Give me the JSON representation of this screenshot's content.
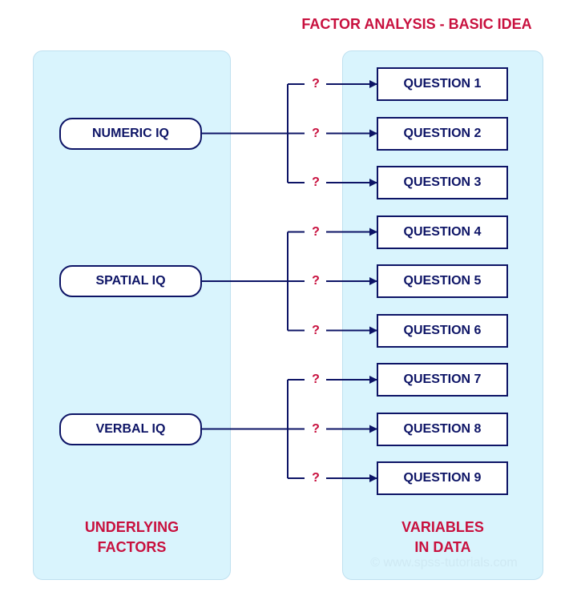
{
  "title": "FACTOR ANALYSIS - BASIC IDEA",
  "colors": {
    "accent": "#c8103e",
    "line": "#0d1466",
    "panel": "#d9f4fd"
  },
  "factors": [
    {
      "label": "NUMERIC IQ",
      "questions": [
        0,
        1,
        2
      ]
    },
    {
      "label": "SPATIAL IQ",
      "questions": [
        3,
        4,
        5
      ]
    },
    {
      "label": "VERBAL IQ",
      "questions": [
        6,
        7,
        8
      ]
    }
  ],
  "questions": [
    "QUESTION 1",
    "QUESTION 2",
    "QUESTION 3",
    "QUESTION 4",
    "QUESTION 5",
    "QUESTION 6",
    "QUESTION 7",
    "QUESTION 8",
    "QUESTION 9"
  ],
  "loading_symbol": "?",
  "footer_left": [
    "UNDERLYING",
    "FACTORS"
  ],
  "footer_right": [
    "VARIABLES",
    "IN DATA"
  ],
  "watermark": "© www.spss-tutorials.com"
}
